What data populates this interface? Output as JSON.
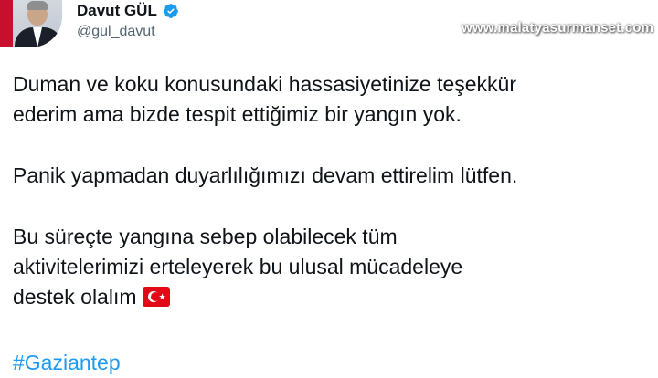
{
  "author": {
    "name": "Davut GÜL",
    "handle": "@gul_davut",
    "verified": true
  },
  "watermark": "www.malatyasurmanset.com",
  "tweet": {
    "paragraph1_line1": "Duman ve koku konusundaki hassasiyetinize teşekkür",
    "paragraph1_line2": "ederim ama bizde tespit ettiğimiz bir yangın yok.",
    "paragraph2": "Panik yapmadan duyarlılığımızı devam ettirelim lütfen.",
    "paragraph3_line1": "Bu süreçte yangına sebep olabilecek tüm",
    "paragraph3_line2": "aktivitelerimizi erteleyerek bu ulusal mücadeleye",
    "paragraph3_line3": "destek olalım",
    "flag_emoji": "turkey-flag-icon",
    "hashtag": "#Gaziantep"
  },
  "colors": {
    "text": "#0f1419",
    "secondary": "#536471",
    "link": "#1d9bf0",
    "verified": "#1d9bf0"
  }
}
